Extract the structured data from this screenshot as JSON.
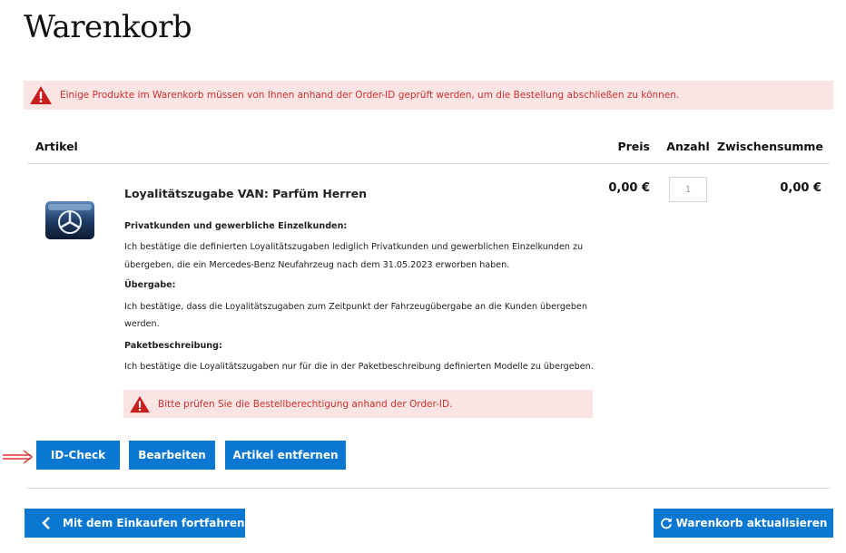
{
  "page": {
    "title": "Warenkorb"
  },
  "alerts": {
    "top": "Einige Produkte im Warenkorb müssen von Ihnen anhand der Order-ID geprüft werden, um die Bestellung abschließen zu können.",
    "item": "Bitte prüfen Sie die Bestellberechtigung anhand der Order-ID."
  },
  "table": {
    "headers": {
      "artikel": "Artikel",
      "preis": "Preis",
      "anzahl": "Anzahl",
      "zwischensumme": "Zwischensumme"
    }
  },
  "item": {
    "name": "Loyalitätszugabe VAN: Parfüm Herren",
    "price": "0,00 €",
    "quantity": "1",
    "subtotal": "0,00 €",
    "description": {
      "privat_heading": "Privatkunden und gewerbliche Einzelkunden:",
      "privat_line1": "Ich bestätige die definierten Loyalitätszugaben lediglich Privatkunden und gewerblichen Einzelkunden zu",
      "privat_line2": "übergeben, die ein Mercedes-Benz Neufahrzeug nach dem 31.05.2023 erworben haben.",
      "uebergabe_heading": "Übergabe:",
      "uebergabe_line1": "Ich bestätige, dass die Loyalitätszugaben zum Zeitpunkt der Fahrzeugübergabe an die Kunden übergeben",
      "uebergabe_line2": "werden.",
      "paket_heading": "Paketbeschreibung:",
      "paket_line1": "Ich bestätige die Loyalitätszugaben nur für die in der Paketbeschreibung definierten Modelle zu übergeben."
    }
  },
  "buttons": {
    "id_check": "ID-Check",
    "edit": "Bearbeiten",
    "remove": "Artikel entfernen",
    "continue_shopping": "Mit dem Einkaufen fortfahren",
    "update_cart": "Warenkorb aktualisieren"
  },
  "icons": {
    "warning": "warning-triangle-icon",
    "chevron": "chevron-left-icon",
    "refresh": "refresh-icon",
    "annotation": "red-arrow-icon"
  },
  "colors": {
    "accent": "#0a78d2",
    "alert_bg": "#fbe4e4",
    "alert_text": "#d0312d",
    "annotation": "#e03030"
  }
}
